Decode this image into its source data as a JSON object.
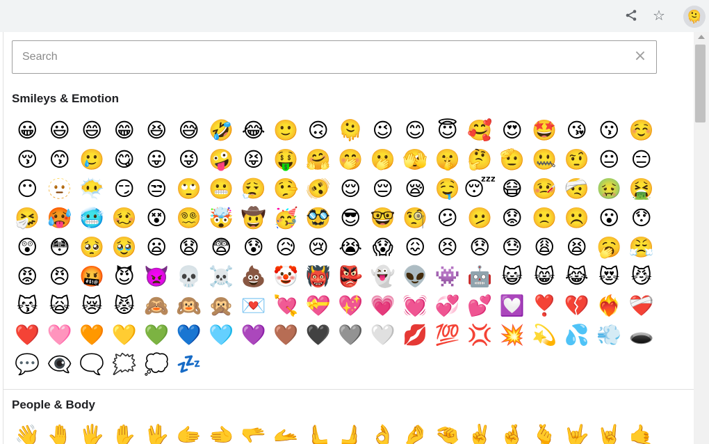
{
  "toolbar": {
    "share_icon": "share-icon",
    "star_icon": "star-icon",
    "extension_icon": "🫠"
  },
  "search": {
    "placeholder": "Search",
    "value": "",
    "clear_icon": "×"
  },
  "categories": [
    {
      "name": "Smileys & Emotion",
      "emojis": [
        "😀",
        "😃",
        "😄",
        "😁",
        "😆",
        "😅",
        "🤣",
        "😂",
        "🙂",
        "🙃",
        "🫠",
        "😉",
        "😊",
        "😇",
        "🥰",
        "😍",
        "🤩",
        "😘",
        "😗",
        "☺️",
        "😚",
        "😙",
        "🥲",
        "😋",
        "😛",
        "😜",
        "🤪",
        "😝",
        "🤑",
        "🤗",
        "🤭",
        "🫢",
        "🫣",
        "🤫",
        "🤔",
        "🫡",
        "🤐",
        "🤨",
        "😐",
        "😑",
        "😶",
        "🫥",
        "😶‍🌫️",
        "😏",
        "😒",
        "🙄",
        "😬",
        "😮‍💨",
        "🤥",
        "🫨",
        "😌",
        "😔",
        "😪",
        "🤤",
        "😴",
        "😷",
        "🤒",
        "🤕",
        "🤢",
        "🤮",
        "🤧",
        "🥵",
        "🥶",
        "🥴",
        "😵",
        "😵‍💫",
        "🤯",
        "🤠",
        "🥳",
        "🥸",
        "😎",
        "🤓",
        "🧐",
        "😕",
        "🫤",
        "😟",
        "🙁",
        "☹️",
        "😮",
        "😯",
        "😲",
        "😳",
        "🥺",
        "🥹",
        "😦",
        "😧",
        "😨",
        "😰",
        "😥",
        "😢",
        "😭",
        "😱",
        "😖",
        "😣",
        "😞",
        "😓",
        "😩",
        "😫",
        "🥱",
        "😤",
        "😡",
        "😠",
        "🤬",
        "😈",
        "👿",
        "💀",
        "☠️",
        "💩",
        "🤡",
        "👹",
        "👺",
        "👻",
        "👽",
        "👾",
        "🤖",
        "😺",
        "😸",
        "😹",
        "😻",
        "😼",
        "😽",
        "🙀",
        "😿",
        "😾",
        "🙈",
        "🙉",
        "🙊",
        "💌",
        "💘",
        "💝",
        "💖",
        "💗",
        "💓",
        "💞",
        "💕",
        "💟",
        "❣️",
        "💔",
        "❤️‍🔥",
        "❤️‍🩹",
        "❤️",
        "🩷",
        "🧡",
        "💛",
        "💚",
        "💙",
        "🩵",
        "💜",
        "🤎",
        "🖤",
        "🩶",
        "🤍",
        "💋",
        "💯",
        "💢",
        "💥",
        "💫",
        "💦",
        "💨",
        "🕳️",
        "💬",
        "👁️‍🗨️",
        "🗨️",
        "🗯️",
        "💭",
        "💤"
      ]
    },
    {
      "name": "People & Body",
      "emojis": [
        "👋",
        "🤚",
        "🖐️",
        "✋",
        "🖖",
        "🫱",
        "🫲",
        "🫳",
        "🫴",
        "🫷",
        "🫸",
        "👌",
        "🤌",
        "🤏",
        "✌️",
        "🤞",
        "🫰",
        "🤟",
        "🤘",
        "🤙"
      ]
    }
  ]
}
